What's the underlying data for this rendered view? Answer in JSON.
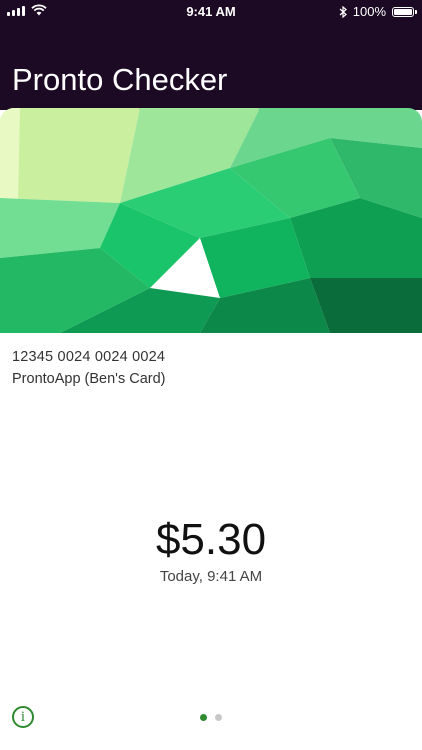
{
  "status_bar": {
    "time": "9:41 AM",
    "battery_percent": "100%",
    "icons": [
      "signal-icon",
      "wifi-icon",
      "bluetooth-icon",
      "battery-icon"
    ]
  },
  "header": {
    "title": "Pronto Checker"
  },
  "card": {
    "number": "12345 0024 0024 0024",
    "name": "ProntoApp (Ben's Card)",
    "colors": {
      "light": "#d5f2a8",
      "mid": "#22c06a",
      "dark": "#0a5a30"
    }
  },
  "balance": {
    "amount": "$5.30",
    "updated": "Today, 9:41 AM"
  },
  "footer": {
    "info_icon": "info-icon",
    "info_glyph": "i",
    "pages": {
      "count": 2,
      "active": 0
    },
    "accent": "#2f8a2f"
  }
}
